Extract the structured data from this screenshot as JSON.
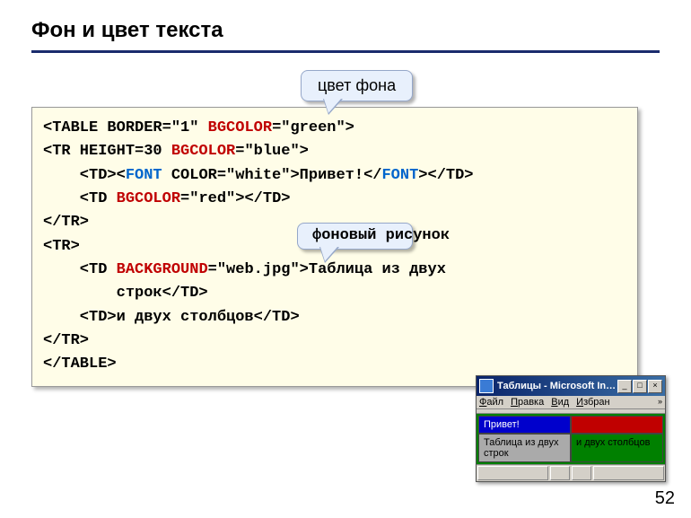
{
  "title": "Фон и цвет текста",
  "callout1": "цвет фона",
  "callout2": "фоновый рисунок",
  "code": {
    "l1a": "<TABLE BORDER=\"1\" ",
    "l1b": "BGCOLOR",
    "l1c": "=\"green\">",
    "l2a": "<TR HEIGHT=30 ",
    "l2b": "BGCOLOR",
    "l2c": "=\"blue\">",
    "l3a": "    <TD><",
    "l3b": "FONT",
    "l3c": " COLOR=\"white\">Привет!</",
    "l3d": "FONT",
    "l3e": "></TD>",
    "l4a": "    <TD ",
    "l4b": "BGCOLOR",
    "l4c": "=\"red\"></TD>",
    "l5": "</TR>",
    "l6": "<TR>",
    "l7a": "    <TD ",
    "l7b": "BACKGROUND",
    "l7c": "=\"web.jpg\">Таблица из двух",
    "l8": "        строк</TD>",
    "l9": "    <TD>и двух столбцов</TD>",
    "l10": "</TR>",
    "l11": "</TABLE>"
  },
  "mini": {
    "title": "Таблицы - Microsoft Intern...",
    "menu": {
      "file": "Файл",
      "edit": "Правка",
      "view": "Вид",
      "fav": "Избран"
    },
    "cells": {
      "a": "Привет!",
      "b": "",
      "c": "Таблица из двух строк",
      "d": "и двух столбцов"
    }
  },
  "page": "52"
}
